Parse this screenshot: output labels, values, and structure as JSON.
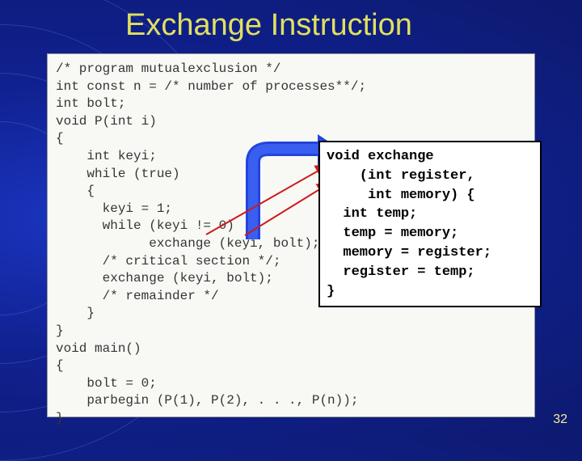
{
  "title": "Exchange Instruction",
  "page_number": "32",
  "code_left": "/* program mutualexclusion */\nint const n = /* number of processes**/;\nint bolt;\nvoid P(int i)\n{\n    int keyi;\n    while (true)\n    {\n      keyi = 1;\n      while (keyi != 0)\n            exchange (keyi, bolt);\n      /* critical section */;\n      exchange (keyi, bolt);\n      /* remainder */\n    }\n}\nvoid main()\n{\n    bolt = 0;\n    parbegin (P(1), P(2), . . ., P(n));\n}",
  "callout": {
    "l1": "void exchange",
    "l2": "    (int register,",
    "l3": "     int memory) {",
    "l4": "  int temp;",
    "l5": "  temp = memory;",
    "l6": "  memory = register;",
    "l7": "  register = temp;",
    "l8": "}"
  }
}
